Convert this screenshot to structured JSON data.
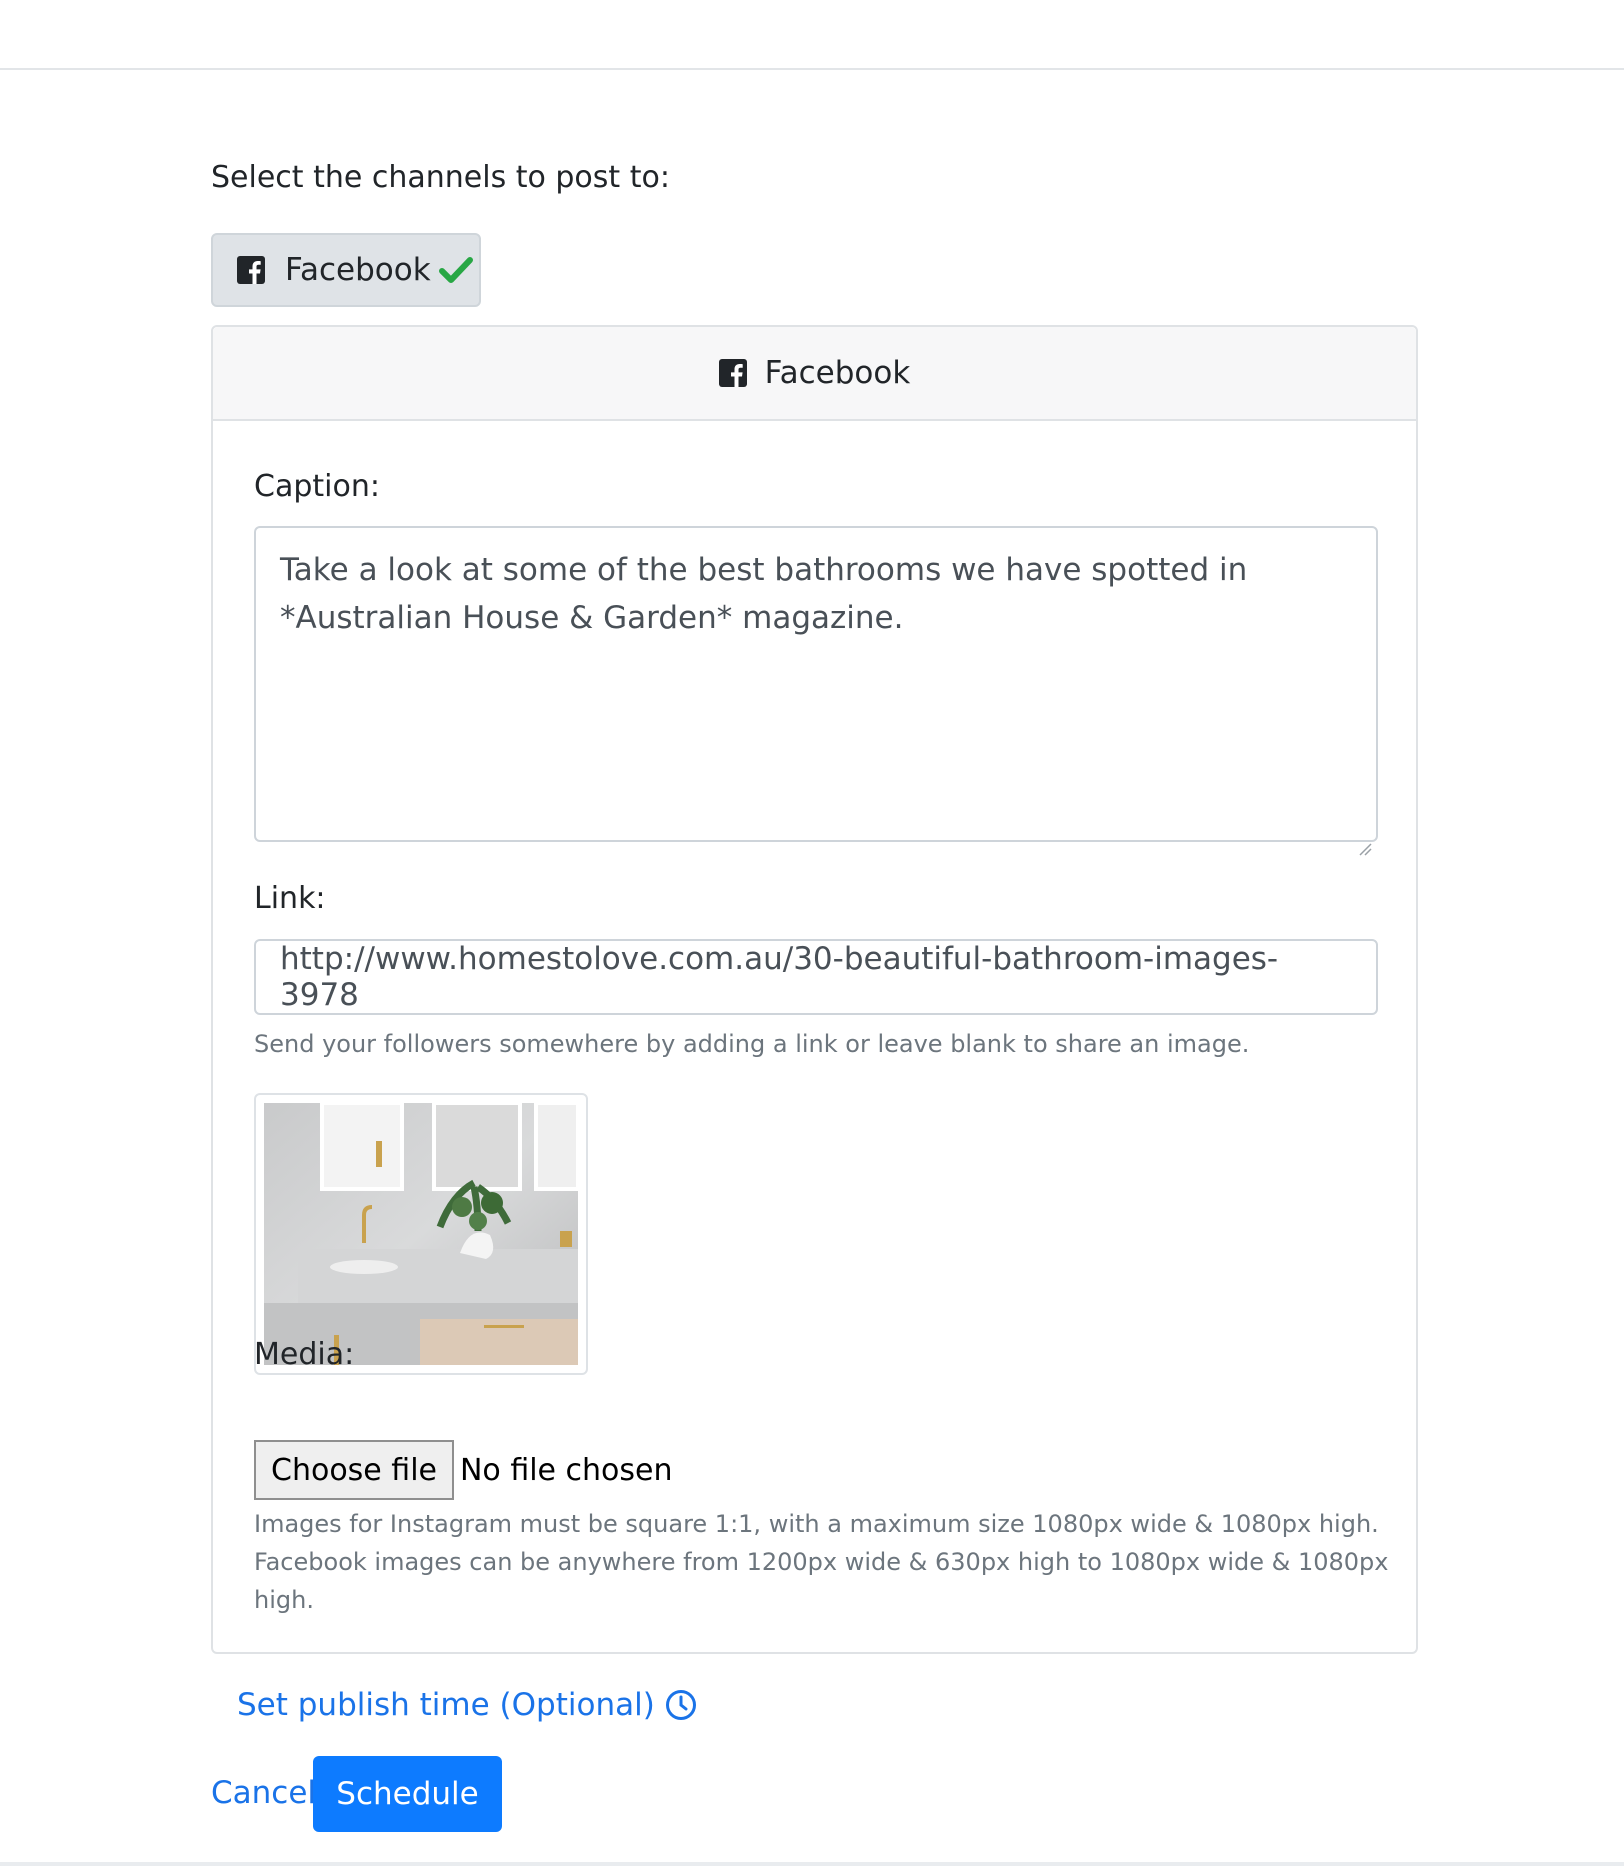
{
  "channels": {
    "prompt": "Select the channels to post to:",
    "selected": [
      {
        "label": "Facebook",
        "icon": "facebook-square-icon",
        "state_icon": "checkmark-icon",
        "check_color": "#28a745"
      }
    ]
  },
  "facebook_card": {
    "header_label": "Facebook",
    "header_icon": "facebook-square-icon",
    "caption": {
      "label": "Caption:",
      "value": "Take a look at some of the best bathrooms we have spotted in *Australian House & Garden* magazine."
    },
    "link": {
      "label": "Link:",
      "value": "http://www.homestolove.com.au/30-beautiful-bathroom-images-3978",
      "help": "Send your followers somewhere by adding a link or leave blank to share an image."
    },
    "media": {
      "label": "Media:",
      "choose_button": "Choose file",
      "file_status": "No file chosen",
      "help_line1": "Images for Instagram must be square 1:1, with a maximum size 1080px wide & 1080px high.",
      "help_line2": "Facebook images can be anywhere from 1200px wide & 630px high to 1080px wide & 1080px high."
    }
  },
  "actions": {
    "publish_time_label": "Set publish time (Optional)",
    "publish_time_icon": "clock-icon",
    "cancel_label": "Cancel",
    "schedule_label": "Schedule",
    "accent_color": "#0d7bff"
  }
}
